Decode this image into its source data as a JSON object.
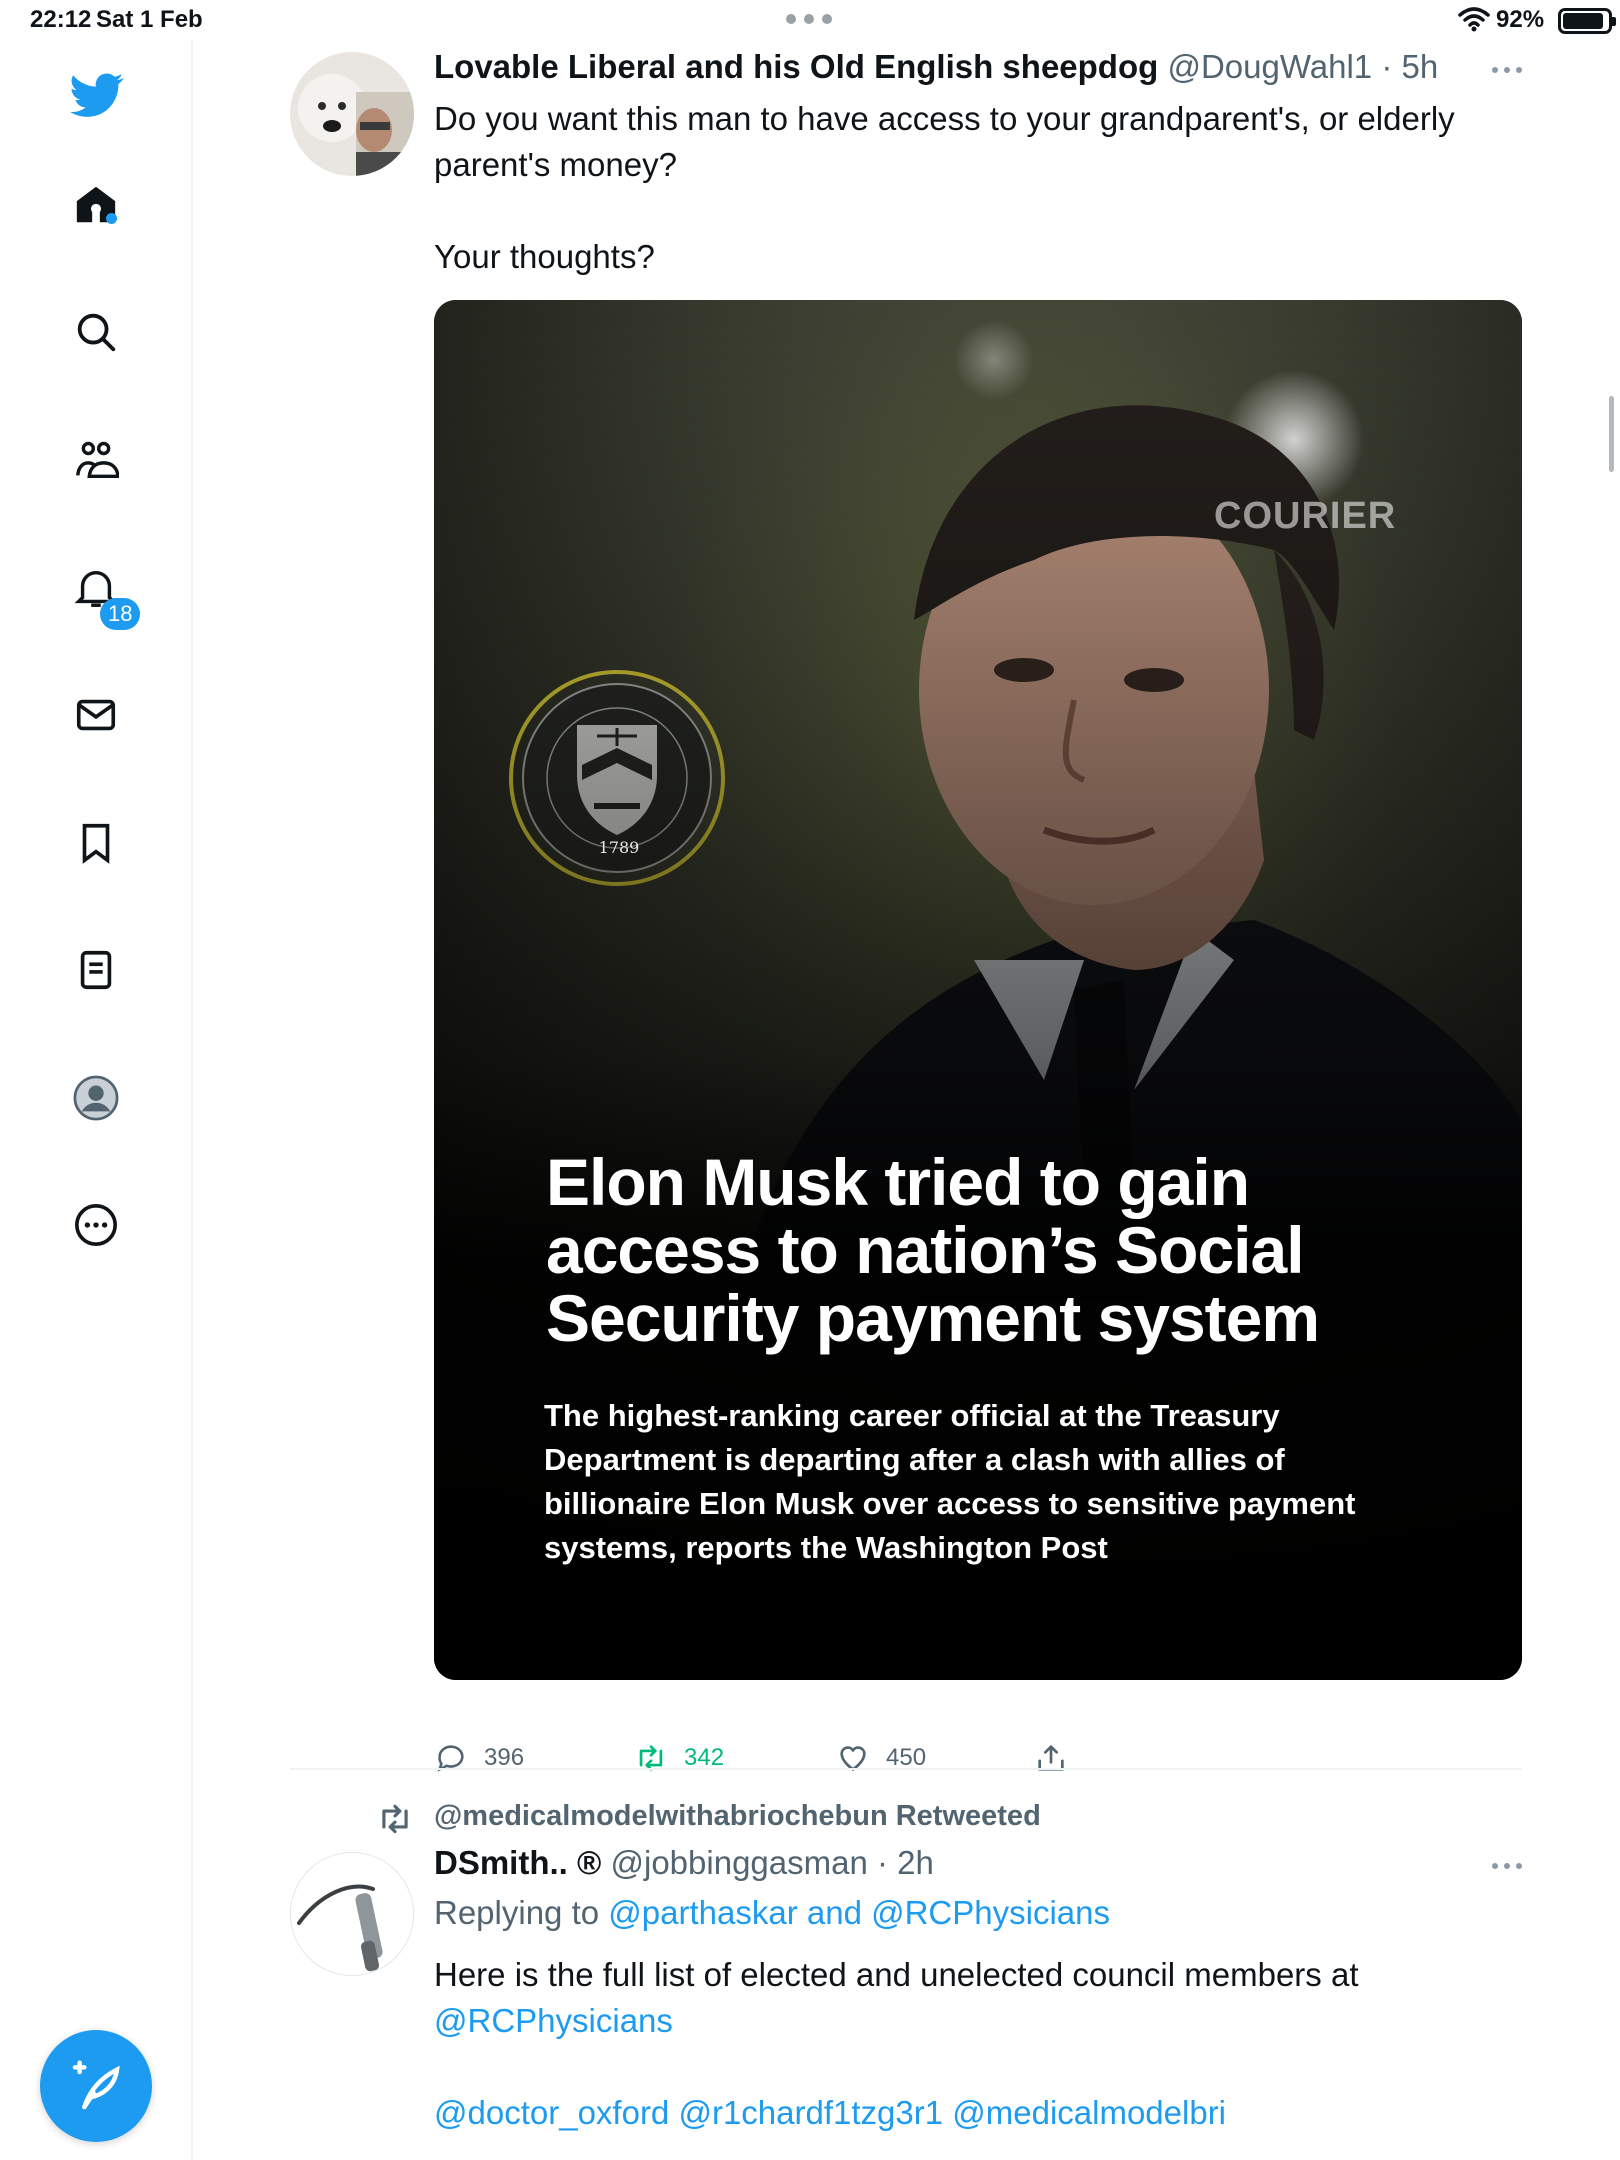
{
  "status_bar": {
    "time": "22:12",
    "date": "Sat 1 Feb",
    "battery": "92%"
  },
  "sidebar": {
    "notifications_badge": "18",
    "accent": "#1d9bf0"
  },
  "tweet1": {
    "name": "Lovable Liberal and his Old English sheepdog",
    "handle_time": "@DougWahl1 · 5h",
    "text_line1": "Do you want this man to have access to your grandparent's, or elderly",
    "text_line2": "parent's money?",
    "text_line3": "Your thoughts?",
    "media": {
      "watermark": "COURIER",
      "seal_text": "THE DEPARTMENT OF THE TREASURY",
      "seal_year": "1789",
      "headline_line1": "Elon Musk tried to gain",
      "headline_line2": "access to nation’s Social",
      "headline_line3": "Security payment system",
      "sub_line1": "The highest-ranking career official at the Treasury",
      "sub_line2": "Department is departing after a clash with allies of",
      "sub_line3": "billionaire Elon Musk over access to sensitive payment",
      "sub_line4": "systems, reports the Washington Post"
    },
    "replies": "396",
    "retweets": "342",
    "likes": "450"
  },
  "tweet2": {
    "retweeted_by": "@medicalmodelwithabriochebun Retweeted",
    "name": "DSmith.. ®",
    "handle_time": "@jobbinggasman · 2h",
    "replying_prefix": "Replying to",
    "replying_to": "@parthaskar and @RCPhysicians",
    "text_line1": "Here is the full list of elected and unelected council members at",
    "text_mention": "@RCPhysicians",
    "text_mentions_line": "@doctor_oxford @r1chardf1tzg3r1 @medicalmodelbri"
  }
}
